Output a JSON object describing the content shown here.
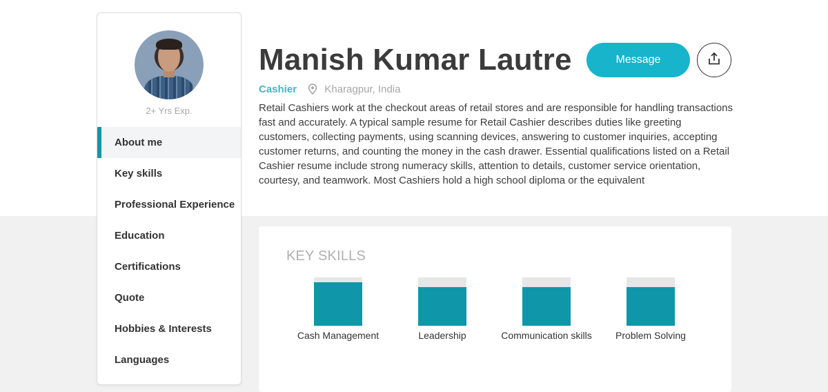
{
  "profile": {
    "name": "Manish Kumar Lautre",
    "role": "Cashier",
    "location": "Kharagpur, India",
    "experience": "2+ Yrs Exp.",
    "bio": "Retail Cashiers work at the checkout areas of retail stores and are responsible for handling transactions fast and accurately. A typical sample resume for Retail Cashier describes duties like greeting customers, collecting payments, using scanning devices, answering to customer inquiries, accepting customer returns, and counting the money in the cash drawer. Essential qualifications listed on a Retail Cashier resume include strong numeracy skills, attention to details, customer service orientation, courtesy, and teamwork. Most Cashiers hold a high school diploma or the equivalent"
  },
  "actions": {
    "message_label": "Message",
    "share_icon": "share-icon"
  },
  "sidebar": {
    "items": [
      {
        "label": "About me",
        "active": true
      },
      {
        "label": "Key skills",
        "active": false
      },
      {
        "label": "Professional Experience",
        "active": false
      },
      {
        "label": "Education",
        "active": false
      },
      {
        "label": "Certifications",
        "active": false
      },
      {
        "label": "Quote",
        "active": false
      },
      {
        "label": "Hobbies & Interests",
        "active": false
      },
      {
        "label": "Languages",
        "active": false
      }
    ]
  },
  "key_skills": {
    "title": "KEY SKILLS",
    "skills": [
      {
        "name": "Cash Management",
        "level": 0.9
      },
      {
        "name": "Leadership",
        "level": 0.8
      },
      {
        "name": "Communication skills",
        "level": 0.8
      },
      {
        "name": "Problem Solving",
        "level": 0.8
      }
    ]
  },
  "colors": {
    "accent": "#18b4cc",
    "bar": "#0f97a9",
    "role": "#45b4c6",
    "active_marker": "#1297a8"
  }
}
